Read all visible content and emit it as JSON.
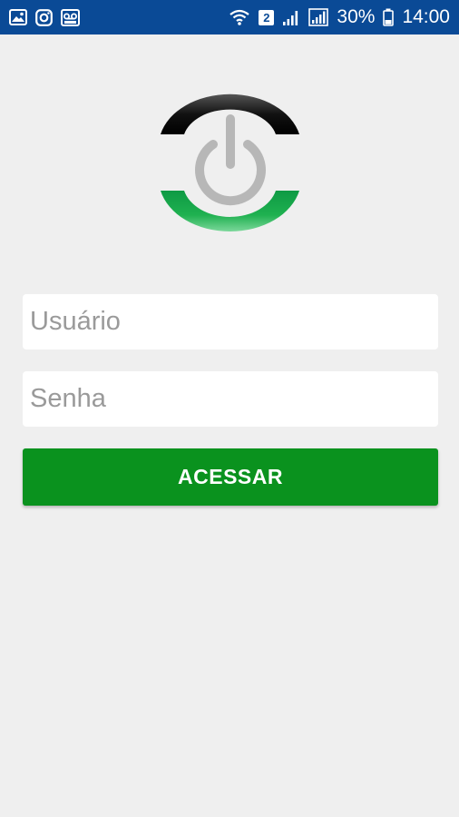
{
  "status_bar": {
    "background": "#0a4a96",
    "left_icons": [
      "gallery-icon",
      "instagram-icon",
      "voicemail-icon"
    ],
    "right_icons": [
      "wifi-icon",
      "sim-badge",
      "signal-icon",
      "signal-icon",
      "battery-icon"
    ],
    "sim_slot": "2",
    "battery": "30%",
    "time": "14:00"
  },
  "logo": {
    "icon": "power-icon",
    "colors": {
      "top_arc": "#1a1a1a",
      "bottom_arc": "#14a24a",
      "power_symbol": "#b7b7b7"
    }
  },
  "login": {
    "username_placeholder": "Usuário",
    "username_value": "",
    "password_placeholder": "Senha",
    "password_value": "",
    "submit_label": "ACESSAR",
    "accent": "#0a921e"
  },
  "page": {
    "background": "#efefef"
  }
}
